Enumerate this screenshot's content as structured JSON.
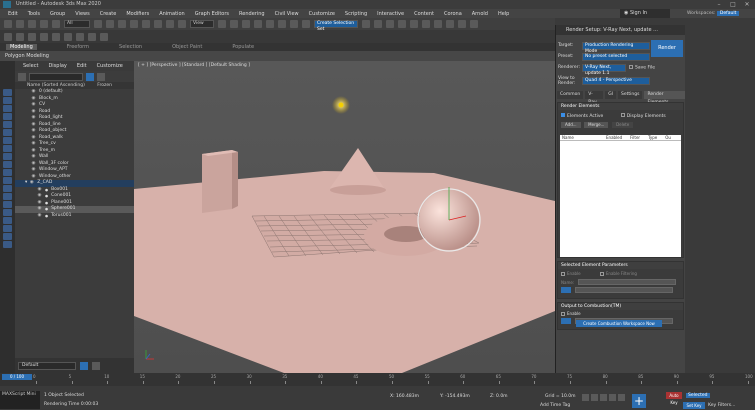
{
  "title_bar": {
    "text": "Untitled - Autodesk 3ds Max 2020"
  },
  "menu": [
    "Edit",
    "Tools",
    "Group",
    "Views",
    "Create",
    "Modifiers",
    "Animation",
    "Graph Editors",
    "Rendering",
    "Civil View",
    "Customize",
    "Scripting",
    "Interactive",
    "Content",
    "Corona",
    "Arnold",
    "Help"
  ],
  "toolbar": {
    "selection_filter": "All",
    "view_dropdown": "View",
    "named_selection": "Create Selection Set"
  },
  "signin": {
    "label": "Sign In"
  },
  "workspaces": {
    "label": "Workspaces:",
    "value": "Default"
  },
  "ribbon_tabs": [
    "Modeling",
    "Freeform",
    "Selection",
    "Object Paint",
    "Populate"
  ],
  "ribbon_label": "Polygon Modeling",
  "scene_explorer": {
    "menu": [
      "Select",
      "Display",
      "Edit",
      "Customize"
    ],
    "header": {
      "name": "Name (Sorted Ascending)",
      "frozen": "Frozen"
    },
    "items": [
      {
        "name": "0 (default)",
        "depth": 0,
        "state": ""
      },
      {
        "name": "Block_m",
        "depth": 0,
        "state": ""
      },
      {
        "name": "CV",
        "depth": 0,
        "state": ""
      },
      {
        "name": "Road",
        "depth": 0,
        "state": ""
      },
      {
        "name": "Road_light",
        "depth": 0,
        "state": ""
      },
      {
        "name": "Road_line",
        "depth": 0,
        "state": ""
      },
      {
        "name": "Road_object",
        "depth": 0,
        "state": ""
      },
      {
        "name": "Road_walk",
        "depth": 0,
        "state": ""
      },
      {
        "name": "Tree_cv",
        "depth": 0,
        "state": ""
      },
      {
        "name": "Tree_m",
        "depth": 0,
        "state": ""
      },
      {
        "name": "Wall",
        "depth": 0,
        "state": ""
      },
      {
        "name": "Wall_3F color",
        "depth": 0,
        "state": ""
      },
      {
        "name": "Window_APT",
        "depth": 0,
        "state": ""
      },
      {
        "name": "Window_other",
        "depth": 0,
        "state": ""
      },
      {
        "name": "Z_CAD",
        "depth": 0,
        "state": "group"
      },
      {
        "name": "Box001",
        "depth": 1,
        "state": ""
      },
      {
        "name": "Cone001",
        "depth": 1,
        "state": ""
      },
      {
        "name": "Plane001",
        "depth": 1,
        "state": ""
      },
      {
        "name": "Sphere001",
        "depth": 1,
        "state": "selected"
      },
      {
        "name": "Torus001",
        "depth": 1,
        "state": ""
      }
    ],
    "layer_field": "Default"
  },
  "viewport": {
    "label": "[ + ] [Perspective ] [Standard ] [Default Shading ]"
  },
  "render_setup": {
    "title": "Render Setup: V-Ray Next, update ...",
    "target_label": "Target:",
    "target_value": "Production Rendering Mode",
    "preset_label": "Preset:",
    "preset_value": "No preset selected",
    "renderer_label": "Renderer:",
    "renderer_value": "V-Ray Next, update 1.1",
    "save_file": "Save File",
    "view_label": "View to Render:",
    "view_value": "Quad 4 - Perspective",
    "render_button": "Render",
    "tabs": [
      "Common",
      "V-Ray",
      "GI",
      "Settings",
      "Render Elements"
    ],
    "active_tab": "Render Elements",
    "section1": {
      "title": "Render Elements",
      "elements_active": "Elements Active",
      "display_elements": "Display Elements",
      "add": "Add...",
      "merge": "Merge...",
      "delete": "Delete"
    },
    "columns": [
      "Name",
      "Enabled",
      "Filter",
      "Type",
      "Ou"
    ],
    "section2": {
      "title": "Selected Element Parameters",
      "enable": "Enable",
      "enable_filtering": "Enable Filtering",
      "name_label": "Name:"
    },
    "section3": {
      "title": "Output to Combustion(TM)",
      "enable": "Enable",
      "button": "Create Combustion Workspace Now"
    }
  },
  "timeline": {
    "frame_display": "0 / 100",
    "ticks": [
      "0",
      "5",
      "10",
      "15",
      "20",
      "25",
      "30",
      "35",
      "40",
      "45",
      "50",
      "55",
      "60",
      "65",
      "70",
      "75",
      "80",
      "85",
      "90",
      "95",
      "100"
    ]
  },
  "status": {
    "selection": "1 Object Selected",
    "render_time": "Rendering Time 0:00:03",
    "coord_x": "X: 160.483m",
    "coord_y": "Y: -154.493m",
    "coord_z": "Z: 0.0m",
    "grid": "Grid = 10.0m",
    "auto_key": "Auto Key",
    "set_key": "Set Key",
    "selected": "Selected",
    "key_filters": "Key Filters...",
    "add_time_tag": "Add Time Tag",
    "maxscript": "MAXScript Mini"
  },
  "colors": {
    "accent": "#2c6fb3",
    "ground": "#d7b1aa",
    "selected_bg": "#5a5a5a"
  }
}
